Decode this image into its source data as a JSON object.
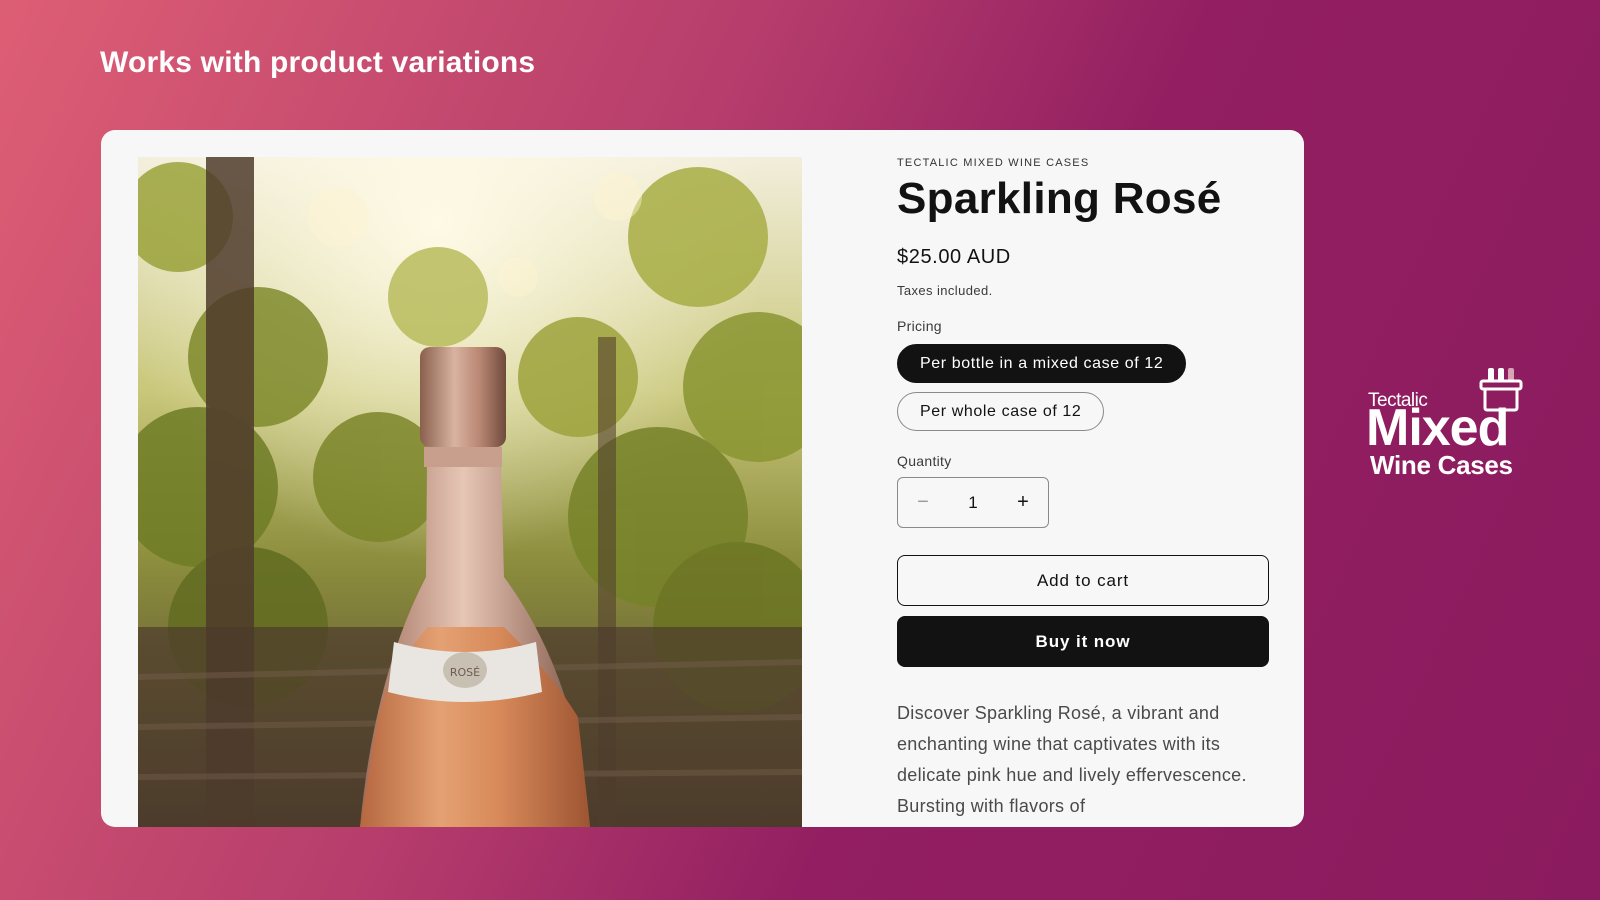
{
  "page": {
    "headline": "Works with product variations"
  },
  "product": {
    "vendor": "TECTALIC MIXED WINE CASES",
    "title": "Sparkling Rosé",
    "price": "$25.00 AUD",
    "tax_note": "Taxes included.",
    "pricing_label": "Pricing",
    "pricing_options": [
      {
        "label": "Per bottle in a mixed case of 12",
        "selected": true
      },
      {
        "label": "Per whole case of 12",
        "selected": false
      }
    ],
    "quantity_label": "Quantity",
    "quantity": {
      "minus": "−",
      "value": "1",
      "plus": "+"
    },
    "add_to_cart": "Add to cart",
    "buy_now": "Buy it now",
    "description": "Discover Sparkling Rosé, a vibrant and enchanting wine that captivates with its delicate pink hue and lively effervescence. Bursting with flavors of"
  },
  "image": {
    "subject": "Sparkling rosé bottle in a vineyard",
    "label_text": "ROSÉ"
  },
  "logo": {
    "small": "Tectalic",
    "big": "Mixed",
    "sub": "Wine Cases"
  },
  "colors": {
    "gradient_start": "#dd5e74",
    "gradient_end": "#8a1b5e",
    "card_bg": "#f8f7f7",
    "primary": "#121212",
    "text_muted": "#4a4a4a"
  }
}
